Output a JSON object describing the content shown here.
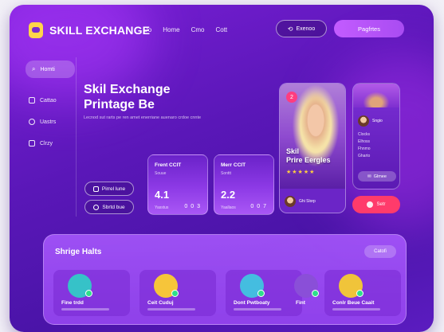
{
  "brand": {
    "name": "SKILL EXCHANGE",
    "icon": "graduation-cap-icon"
  },
  "nav": [
    "Do",
    "Home",
    "Cmo",
    "Cott"
  ],
  "header": {
    "explore_label": "Exenoo",
    "cta_label": "Pagfrtes"
  },
  "sidebar": {
    "items": [
      {
        "label": "Homti",
        "icon": "search-icon"
      },
      {
        "label": "Cattao",
        "icon": "chat-icon"
      },
      {
        "label": "Uastrs",
        "icon": "users-icon"
      },
      {
        "label": "Clrzy",
        "icon": "calendar-icon"
      }
    ]
  },
  "hero": {
    "title_line1": "Skil Exchange",
    "title_line2": "Printage Be",
    "subtitle": "Lecnod sut rarts pe ren amet enerriane auenaro crdoe cnnte",
    "buttons": [
      "Pirrel lune",
      "Sbrtd bue"
    ]
  },
  "stats": [
    {
      "label": "Frent CCIT",
      "sub": "Souue",
      "value": "4.1",
      "foot": "Yasstus",
      "count": "0 0 3"
    },
    {
      "label": "Merr CCIT",
      "sub": "Sonttt",
      "value": "2.2",
      "foot": "Yaallaos",
      "count": "0 0 7"
    }
  ],
  "profile": {
    "badge": "2",
    "title_line1": "Skil",
    "title_line2": "Prire Eergles",
    "rating_stars": "★★★★★",
    "rating_value": 5,
    "meta": "Ghi Slorp"
  },
  "side_profile": {
    "name": "Sngio",
    "lines": [
      "Clocks",
      "Elhoss",
      "Fhnmo",
      "Gharto"
    ],
    "button": "Glmee"
  },
  "danger_button": {
    "label": "Setr"
  },
  "panel": {
    "title": "Shrige Halts",
    "action": "Catofi",
    "users": [
      {
        "name": "Fine trdd",
        "avatar_color": "#36c2c8"
      },
      {
        "name": "Ceit Cuduj",
        "avatar_color": "#f6c53a"
      },
      {
        "name": "Dont Pwtboaty",
        "avatar_color": "#44bde0"
      },
      {
        "name": "Fint",
        "avatar_color": "#8a4fd8"
      },
      {
        "name": "Conlr Beue Caait",
        "avatar_color": "#f0c43a"
      }
    ]
  },
  "colors": {
    "accent": "#a94cf2",
    "danger": "#ff3b6b",
    "star": "#ffcf3f",
    "online": "#2ee08b"
  }
}
